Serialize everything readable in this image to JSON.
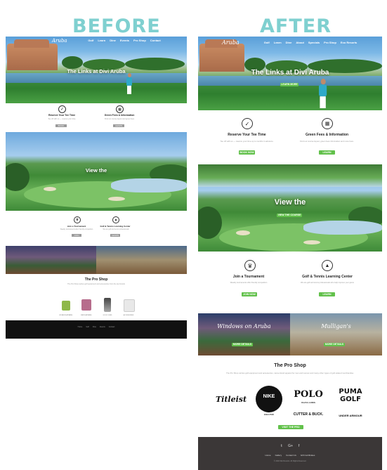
{
  "labels": {
    "before": "BEFORE",
    "after": "AFTER"
  },
  "colors": {
    "heading": "#7fd0d0",
    "accent_green": "#62c14b",
    "footer_dark": "#3b3737",
    "footer_black": "#111111"
  },
  "before": {
    "logo": "Aruba",
    "nav": [
      "Golf",
      "Learn",
      "Dine",
      "Events",
      "Pro Shop",
      "Contact"
    ],
    "hero_title": "The Links at Divi Aruba",
    "features": [
      {
        "icon": "check-icon",
        "title": "Reserve Your Tee Time",
        "desc": "Tee off with us — reserve your time",
        "button": "BOOK NOW"
      },
      {
        "icon": "map-icon",
        "title": "Green Fees & Information",
        "desc": "Find our course layout and green fees",
        "button": "LEARN MORE"
      }
    ],
    "view_title": "View the",
    "features2": [
      {
        "icon": "trophy-icon",
        "title": "Join a Tournament",
        "desc": "Weekly tournaments after friendly competition",
        "button": "JOIN NOW"
      },
      {
        "icon": "graduation-cap-icon",
        "title": "Golf & Tennis Learning Center",
        "desc": "We are golf and tennis professionals",
        "button": "LEARN MORE"
      }
    ],
    "proshop_title": "The Pro Shop",
    "proshop_desc": "The Pro Shop carries golf equipment and accessories from the top brands",
    "products": [
      "WOMEN'S APPAREL",
      "MEN'S APPAREL",
      "GOLF CLUBS",
      "ACCESSORIES"
    ],
    "footer_links": [
      "Home",
      "Golf",
      "Dine",
      "Events",
      "Contact"
    ]
  },
  "after": {
    "logo": "Aruba",
    "nav": [
      "Golf",
      "Learn",
      "Dine",
      "About",
      "Specials",
      "Pro Shop",
      "Eco Resorts"
    ],
    "hero_title": "The Links at Divi Aruba",
    "hero_button": "LEARN MORE",
    "features": [
      {
        "icon": "check-icon",
        "title": "Reserve Your Tee Time",
        "desc": "Tee off with us — reserve your time up to months in advance.",
        "button": "BOOK NOW"
      },
      {
        "icon": "map-icon",
        "title": "Green Fees & Information",
        "desc": "Find our course layout, green fees information and more here.",
        "button": "LEARN MORE"
      }
    ],
    "view_title": "View the",
    "view_button": "VIEW THE COURSE",
    "features2": [
      {
        "icon": "trophy-icon",
        "title": "Join a Tournament",
        "desc": "Weekly tournaments offer friendly competition",
        "button": "JOIN NOW"
      },
      {
        "icon": "graduation-cap-icon",
        "title": "Golf & Tennis Learning Center",
        "desc": "We are golf and tennis professionals who help improve your game",
        "button": "LEARN MORE"
      }
    ],
    "dine_script": "Windows on Aruba",
    "dine_script2": "Mulligan's",
    "dine_button": "MORE DETAILS",
    "dine_button2": "MORE DETAILS",
    "proshop_title": "The Pro Shop",
    "proshop_desc": "The Pro Shop carries golf equipment and accessories, name-brand apparel for men and women and many other types of golf-related merchandise.",
    "brands": [
      "Titleist",
      "NIKE",
      "POLO",
      "PUMA GOLF"
    ],
    "brands_sub": [
      "CUTTER & BUCK.",
      "UNDER ARMOUR"
    ],
    "nike_sub": "EXECUTIVE",
    "polo_sub": "RALPH LAUREN",
    "shop_button": "VISIT THE PRO SHOP",
    "footer_social": [
      "twitter-icon",
      "google-plus-icon",
      "facebook-icon"
    ],
    "footer_links": [
      "Home",
      "Gallery",
      "Contact Us",
      "Gift Certificates"
    ],
    "footer_copy": "© 2016 Divi Resorts. All Rights Reserved."
  }
}
